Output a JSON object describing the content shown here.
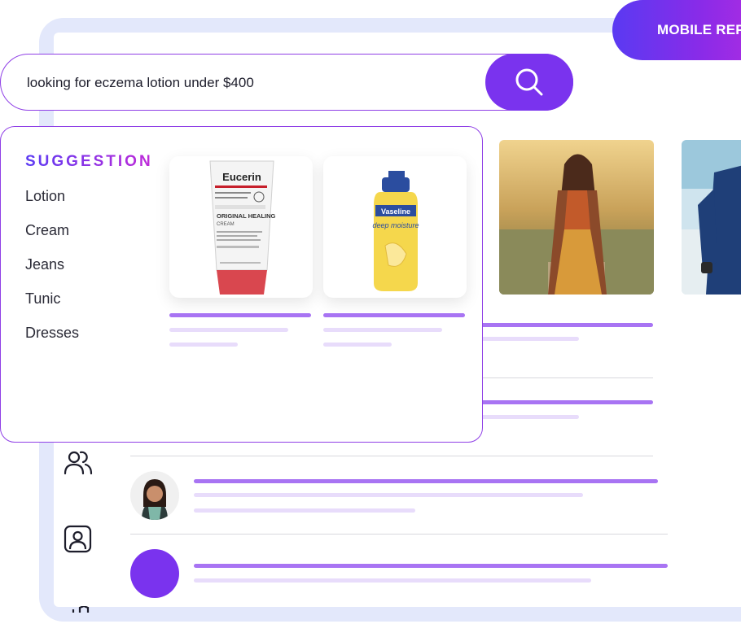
{
  "header": {
    "pill_label": "MOBILE REP"
  },
  "search": {
    "query": "looking for eczema lotion under $400",
    "placeholder": ""
  },
  "suggestions": {
    "title": "SUGGESTION",
    "items": [
      "Lotion",
      "Cream",
      "Jeans",
      "Tunic",
      "Dresses"
    ]
  },
  "products": [
    {
      "brand": "Eucerin",
      "text": "ORIGINAL HEALING",
      "subtext": "CREAM"
    },
    {
      "brand": "Vaseline",
      "text": "deep moisture"
    }
  ],
  "icons": [
    "search-icon",
    "people-icon",
    "contact-card-icon"
  ],
  "colors": {
    "accent": "#7a33ee",
    "line_strong": "#a874f3",
    "line_soft": "#e8dcfb",
    "frame": "#e3e8fb"
  }
}
